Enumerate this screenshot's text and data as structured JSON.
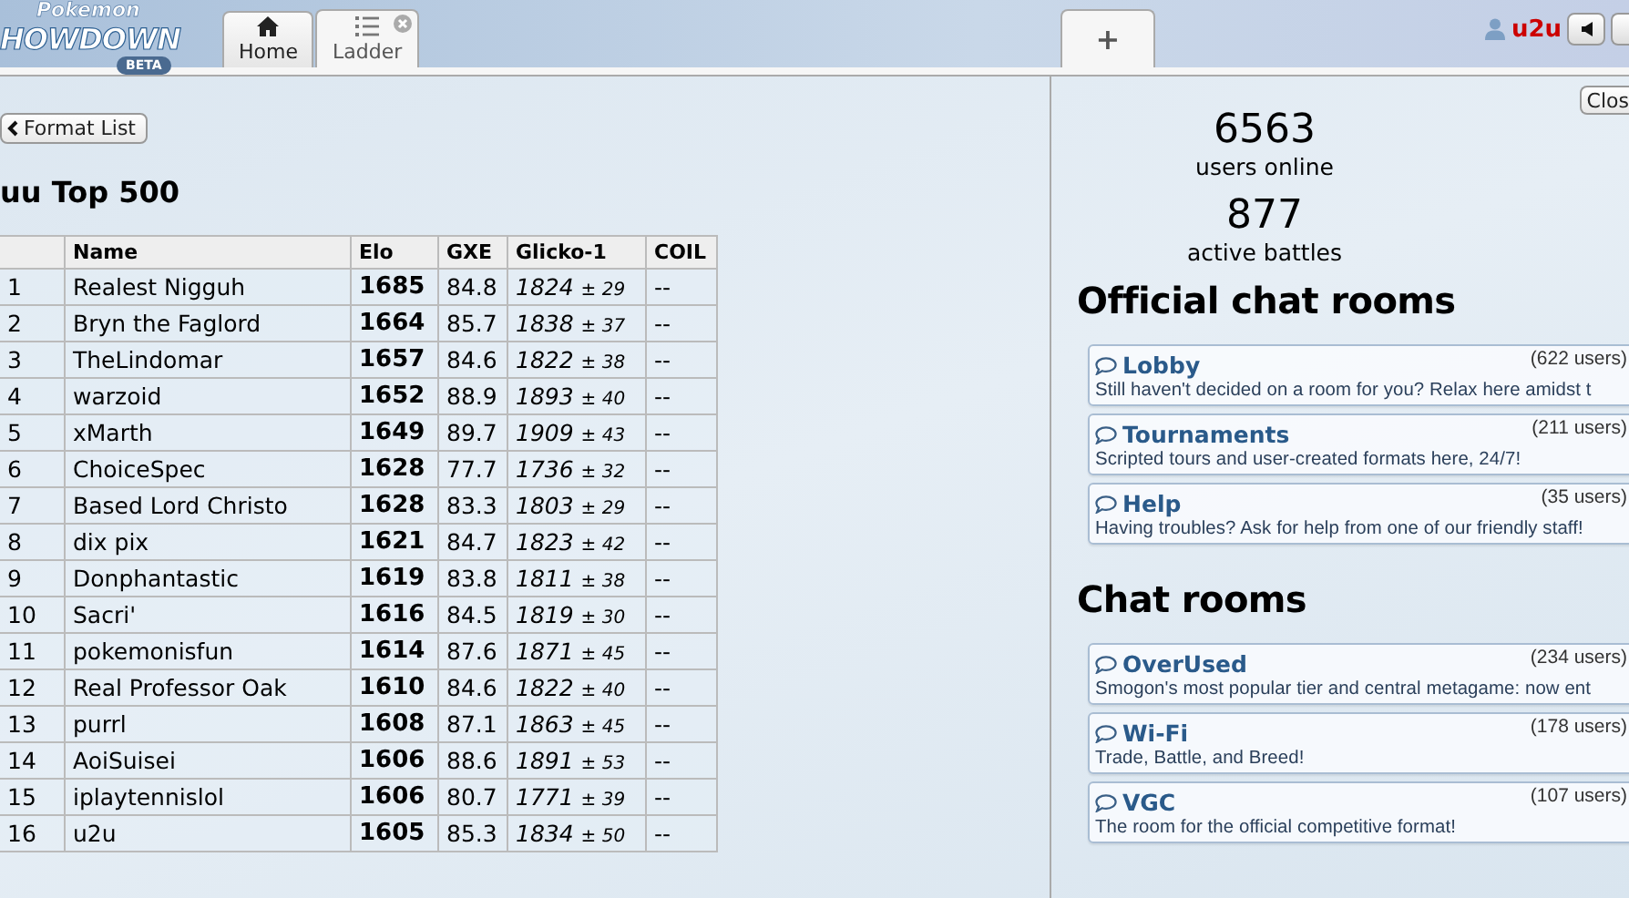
{
  "header": {
    "logo": {
      "top": "Pokemon",
      "main": "HOWDOWN",
      "badge": "BETA"
    },
    "tabs": [
      {
        "label": "Home",
        "kind": "home",
        "selected": false,
        "closable": false
      },
      {
        "label": "Ladder",
        "kind": "list",
        "selected": true,
        "closable": true
      }
    ],
    "new_tab": {
      "label": "+"
    },
    "user": {
      "name": "u2u"
    }
  },
  "ladder": {
    "back_button": "Format List",
    "title": "uu Top 500",
    "columns": [
      "",
      "Name",
      "Elo",
      "GXE",
      "Glicko-1",
      "COIL"
    ],
    "rows": [
      {
        "rank": "1",
        "name": "Realest Nigguh",
        "elo": "1685",
        "gxe": "84.8",
        "rating": "1824",
        "deviation": "± 29",
        "coil": "--"
      },
      {
        "rank": "2",
        "name": "Bryn the Faglord",
        "elo": "1664",
        "gxe": "85.7",
        "rating": "1838",
        "deviation": "± 37",
        "coil": "--"
      },
      {
        "rank": "3",
        "name": "TheLindomar",
        "elo": "1657",
        "gxe": "84.6",
        "rating": "1822",
        "deviation": "± 38",
        "coil": "--"
      },
      {
        "rank": "4",
        "name": "warzoid",
        "elo": "1652",
        "gxe": "88.9",
        "rating": "1893",
        "deviation": "± 40",
        "coil": "--"
      },
      {
        "rank": "5",
        "name": "xMarth",
        "elo": "1649",
        "gxe": "89.7",
        "rating": "1909",
        "deviation": "± 43",
        "coil": "--"
      },
      {
        "rank": "6",
        "name": "ChoiceSpec",
        "elo": "1628",
        "gxe": "77.7",
        "rating": "1736",
        "deviation": "± 32",
        "coil": "--"
      },
      {
        "rank": "7",
        "name": "Based Lord Christo",
        "elo": "1628",
        "gxe": "83.3",
        "rating": "1803",
        "deviation": "± 29",
        "coil": "--"
      },
      {
        "rank": "8",
        "name": "dix pix",
        "elo": "1621",
        "gxe": "84.7",
        "rating": "1823",
        "deviation": "± 42",
        "coil": "--"
      },
      {
        "rank": "9",
        "name": "Donphantastic",
        "elo": "1619",
        "gxe": "83.8",
        "rating": "1811",
        "deviation": "± 38",
        "coil": "--"
      },
      {
        "rank": "10",
        "name": "Sacri'",
        "elo": "1616",
        "gxe": "84.5",
        "rating": "1819",
        "deviation": "± 30",
        "coil": "--"
      },
      {
        "rank": "11",
        "name": "pokemonisfun",
        "elo": "1614",
        "gxe": "87.6",
        "rating": "1871",
        "deviation": "± 45",
        "coil": "--"
      },
      {
        "rank": "12",
        "name": "Real Professor Oak",
        "elo": "1610",
        "gxe": "84.6",
        "rating": "1822",
        "deviation": "± 40",
        "coil": "--"
      },
      {
        "rank": "13",
        "name": "purrl",
        "elo": "1608",
        "gxe": "87.1",
        "rating": "1863",
        "deviation": "± 45",
        "coil": "--"
      },
      {
        "rank": "14",
        "name": "AoiSuisei",
        "elo": "1606",
        "gxe": "88.6",
        "rating": "1891",
        "deviation": "± 53",
        "coil": "--"
      },
      {
        "rank": "15",
        "name": "iplaytennislol",
        "elo": "1606",
        "gxe": "80.7",
        "rating": "1771",
        "deviation": "± 39",
        "coil": "--"
      },
      {
        "rank": "16",
        "name": "u2u",
        "elo": "1605",
        "gxe": "85.3",
        "rating": "1834",
        "deviation": "± 50",
        "coil": "--"
      }
    ]
  },
  "home": {
    "close_button": "Clos",
    "stats": [
      {
        "value": "6563",
        "label": "users online"
      },
      {
        "value": "877",
        "label": "active battles"
      }
    ],
    "sections": [
      {
        "title": "Official chat rooms",
        "rooms": [
          {
            "name": "Lobby",
            "users": "(622 users)",
            "description": "Still haven't decided on a room for you? Relax here amidst t"
          },
          {
            "name": "Tournaments",
            "users": "(211 users)",
            "description": "Scripted tours and user-created formats here, 24/7!"
          },
          {
            "name": "Help",
            "users": "(35 users)",
            "description": "Having troubles? Ask for help from one of our friendly staff!"
          }
        ]
      },
      {
        "title": "Chat rooms",
        "rooms": [
          {
            "name": "OverUsed",
            "users": "(234 users)",
            "description": "Smogon's most popular tier and central metagame: now ent"
          },
          {
            "name": "Wi-Fi",
            "users": "(178 users)",
            "description": "Trade, Battle, and Breed!"
          },
          {
            "name": "VGC",
            "users": "(107 users)",
            "description": "The room for the official competitive format!"
          }
        ]
      }
    ]
  }
}
